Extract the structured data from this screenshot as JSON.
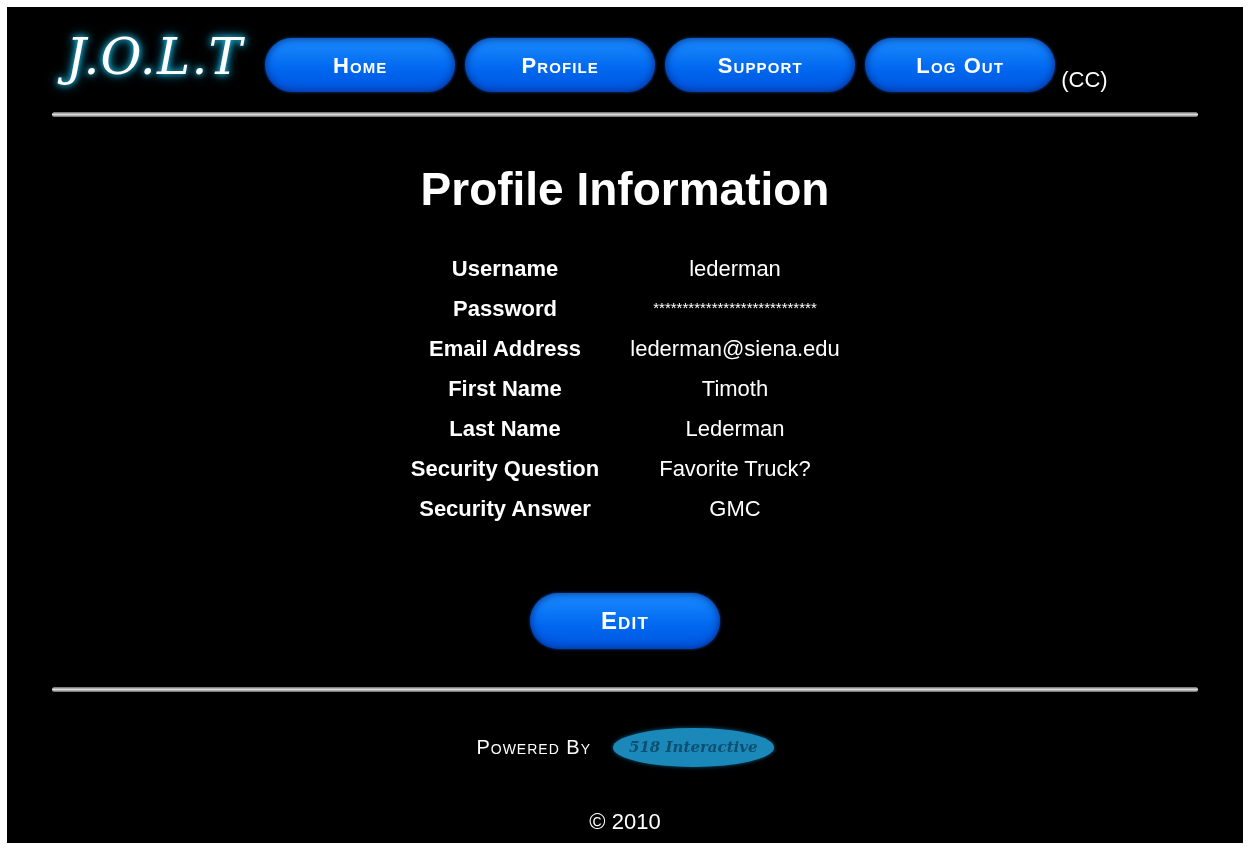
{
  "header": {
    "logo": "J.O.L.T",
    "nav": [
      {
        "label": "Home"
      },
      {
        "label": "Profile"
      },
      {
        "label": "Support"
      },
      {
        "label": "Log Out"
      }
    ],
    "cc": "(CC)"
  },
  "profile": {
    "title": "Profile Information",
    "fields": [
      {
        "label": "Username",
        "value": "lederman"
      },
      {
        "label": "Password",
        "value": "****************************"
      },
      {
        "label": "Email Address",
        "value": "lederman@siena.edu"
      },
      {
        "label": "First Name",
        "value": "Timoth"
      },
      {
        "label": "Last Name",
        "value": "Lederman"
      },
      {
        "label": "Security Question",
        "value": "Favorite Truck?"
      },
      {
        "label": "Security Answer",
        "value": "GMC"
      }
    ],
    "edit_button": "Edit"
  },
  "footer": {
    "powered_by": "Powered By",
    "partner_logo": "518 Interactive",
    "copyright": "© 2010"
  }
}
